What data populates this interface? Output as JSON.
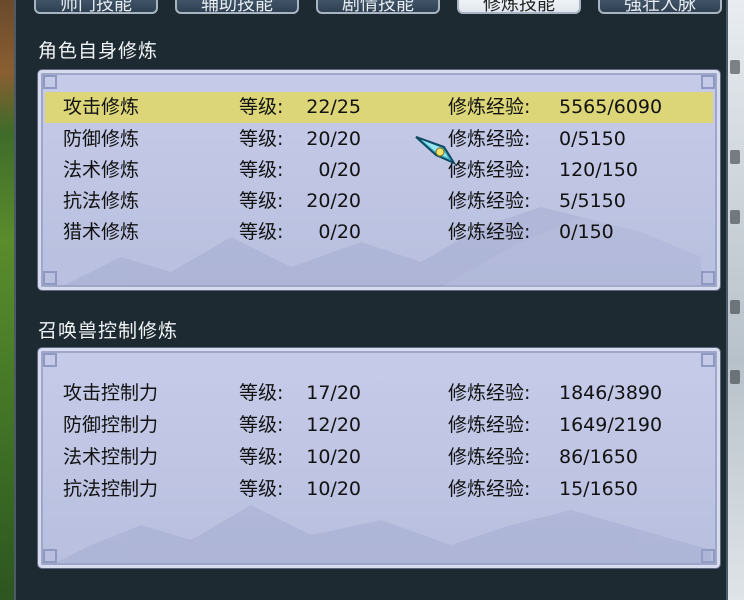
{
  "tabs": [
    {
      "label": "师门技能",
      "active": false
    },
    {
      "label": "辅助技能",
      "active": false
    },
    {
      "label": "剧情技能",
      "active": false
    },
    {
      "label": "修炼技能",
      "active": true
    },
    {
      "label": "强壮人脉",
      "active": false
    }
  ],
  "character_section": {
    "title": "角色自身修炼",
    "level_label": "等级:",
    "exp_label": "修炼经验:",
    "rows": [
      {
        "name": "攻击修炼",
        "level": "22/25",
        "exp": "5565/6090",
        "selected": true
      },
      {
        "name": "防御修炼",
        "level": "20/20",
        "exp": "0/5150",
        "selected": false
      },
      {
        "name": "法术修炼",
        "level": "0/20",
        "exp": "120/150",
        "selected": false
      },
      {
        "name": "抗法修炼",
        "level": "20/20",
        "exp": "5/5150",
        "selected": false
      },
      {
        "name": "猎术修炼",
        "level": "0/20",
        "exp": "0/150",
        "selected": false
      }
    ]
  },
  "pet_section": {
    "title": "召唤兽控制修炼",
    "level_label": "等级:",
    "exp_label": "修炼经验:",
    "rows": [
      {
        "name": "攻击控制力",
        "level": "17/20",
        "exp": "1846/3890"
      },
      {
        "name": "防御控制力",
        "level": "12/20",
        "exp": "1649/2190"
      },
      {
        "name": "法术控制力",
        "level": "10/20",
        "exp": "86/1650"
      },
      {
        "name": "抗法控制力",
        "level": "10/20",
        "exp": "15/1650"
      }
    ]
  },
  "colors": {
    "selected_row": "#dcd678",
    "panel": "#c5cbe8",
    "dialog_bg": "#1e2a32",
    "title_text": "#f1f4f6"
  }
}
